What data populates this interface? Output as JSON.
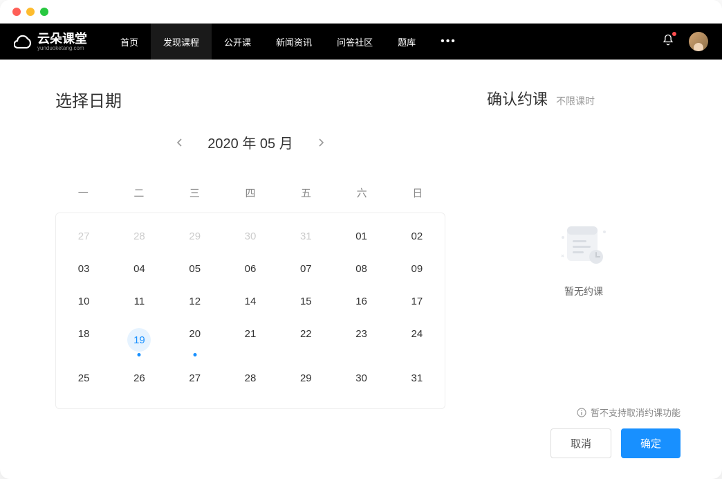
{
  "logo": {
    "text": "云朵课堂",
    "sub": "yunduoketang.com"
  },
  "nav": {
    "items": [
      "首页",
      "发现课程",
      "公开课",
      "新闻资讯",
      "问答社区",
      "题库"
    ],
    "activeIndex": 1
  },
  "left": {
    "title": "选择日期",
    "calendar": {
      "period": "2020 年 05 月",
      "weekdays": [
        "一",
        "二",
        "三",
        "四",
        "五",
        "六",
        "日"
      ],
      "cells": [
        {
          "d": "27",
          "muted": true
        },
        {
          "d": "28",
          "muted": true
        },
        {
          "d": "29",
          "muted": true
        },
        {
          "d": "30",
          "muted": true
        },
        {
          "d": "31",
          "muted": true
        },
        {
          "d": "01"
        },
        {
          "d": "02"
        },
        {
          "d": "03"
        },
        {
          "d": "04"
        },
        {
          "d": "05"
        },
        {
          "d": "06"
        },
        {
          "d": "07"
        },
        {
          "d": "08"
        },
        {
          "d": "09"
        },
        {
          "d": "10"
        },
        {
          "d": "11"
        },
        {
          "d": "12"
        },
        {
          "d": "14"
        },
        {
          "d": "15"
        },
        {
          "d": "16"
        },
        {
          "d": "17"
        },
        {
          "d": "18"
        },
        {
          "d": "19",
          "today": true,
          "dot": true
        },
        {
          "d": "20",
          "dot": true
        },
        {
          "d": "21"
        },
        {
          "d": "22"
        },
        {
          "d": "23"
        },
        {
          "d": "24"
        },
        {
          "d": "25"
        },
        {
          "d": "26"
        },
        {
          "d": "27"
        },
        {
          "d": "28"
        },
        {
          "d": "29"
        },
        {
          "d": "30"
        },
        {
          "d": "31"
        }
      ]
    }
  },
  "right": {
    "title": "确认约课",
    "sub": "不限课时",
    "emptyText": "暂无约课",
    "note": "暂不支持取消约课功能",
    "cancel": "取消",
    "confirm": "确定"
  }
}
